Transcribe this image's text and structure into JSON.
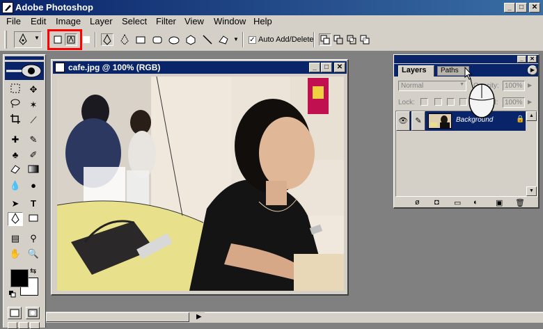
{
  "app": {
    "title": "Adobe Photoshop"
  },
  "menu": [
    "File",
    "Edit",
    "Image",
    "Layer",
    "Select",
    "Filter",
    "View",
    "Window",
    "Help"
  ],
  "options": {
    "auto_add_delete": "Auto Add/Delete"
  },
  "document": {
    "title": "cafe.jpg @ 100% (RGB)"
  },
  "layers_panel": {
    "tabs": [
      "Layers",
      "Paths"
    ],
    "blend_mode": "Normal",
    "opacity_label": "Opacity:",
    "opacity_value": "100%",
    "lock_label": "Lock:",
    "fill_label": "Fill:",
    "fill_value": "100%",
    "layer_name": "Background"
  },
  "colors": {
    "title_bar": "#0a246a",
    "highlight": "#ff0000",
    "selected_layer": "#0a246a"
  }
}
